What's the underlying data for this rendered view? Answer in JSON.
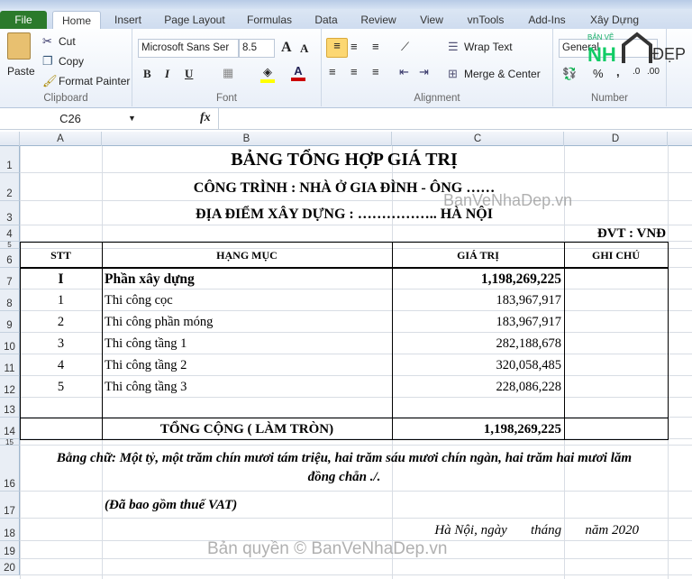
{
  "ribbon": {
    "tabs": [
      "File",
      "Home",
      "Insert",
      "Page Layout",
      "Formulas",
      "Data",
      "Review",
      "View",
      "vnTools",
      "Add-Ins",
      "Xây Dựng"
    ],
    "active_tab": "Home",
    "clipboard": {
      "paste": "Paste",
      "cut": "Cut",
      "copy": "Copy",
      "format_painter": "Format Painter",
      "label": "Clipboard"
    },
    "font": {
      "name": "Microsoft Sans Ser",
      "size": "8.5",
      "bold": "B",
      "italic": "I",
      "underline": "U",
      "label": "Font",
      "fill_color": "#ffff00",
      "font_color": "#cc0000"
    },
    "alignment": {
      "wrap_text": "Wrap Text",
      "merge_center": "Merge & Center",
      "label": "Alignment"
    },
    "number": {
      "format": "General",
      "percent": "%",
      "comma": ",",
      "label": "Number"
    }
  },
  "formula_bar": {
    "name_box": "C26",
    "fx": "fx",
    "value": ""
  },
  "columns": [
    "A",
    "B",
    "C",
    "D"
  ],
  "rows": [
    "1",
    "2",
    "3",
    "4",
    "5",
    "6",
    "7",
    "8",
    "9",
    "10",
    "11",
    "12",
    "13",
    "14",
    "15",
    "16",
    "17",
    "18",
    "19",
    "20"
  ],
  "sheet": {
    "title": "BẢNG TỔNG HỢP GIÁ TRỊ",
    "project": "CÔNG TRÌNH : NHÀ Ở GIA ĐÌNH - ÔNG ……",
    "location": "ĐỊA ĐIỂM XÂY DỰNG : …………….. HÀ NỘI",
    "unit": "ĐVT : VNĐ",
    "headers": [
      "STT",
      "HẠNG MỤC",
      "GIÁ TRỊ",
      "GHI CHÚ"
    ],
    "items": [
      {
        "stt": "I",
        "name": "Phần xây dựng",
        "value": "1,198,269,225",
        "bold": true
      },
      {
        "stt": "1",
        "name": "Thi công cọc",
        "value": "183,967,917"
      },
      {
        "stt": "2",
        "name": "Thi công phần móng",
        "value": "183,967,917"
      },
      {
        "stt": "3",
        "name": "Thi công tầng 1",
        "value": "282,188,678"
      },
      {
        "stt": "4",
        "name": "Thi công tầng 2",
        "value": "320,058,485"
      },
      {
        "stt": "5",
        "name": "Thi công tầng 3",
        "value": "228,086,228"
      }
    ],
    "total_label": "TỔNG CỘNG ( LÀM TRÒN)",
    "total_value": "1,198,269,225",
    "in_words_1": "Bằng chữ: Một tỷ, một trăm chín mươi tám triệu, hai trăm sáu mươi chín ngàn, hai trăm hai mươi lăm",
    "in_words_2": "đồng chẵn ./.",
    "vat_note": "(Đã bao gồm thuế VAT)",
    "date_line": "Hà Nội, ngày       tháng       năm 2020"
  },
  "watermarks": {
    "logo": "BẢN VẼ NHÀ ĐẸP",
    "site": "BanVeNhaDep.vn",
    "copyright": "Bản quyền © BanVeNhaDep.vn"
  }
}
